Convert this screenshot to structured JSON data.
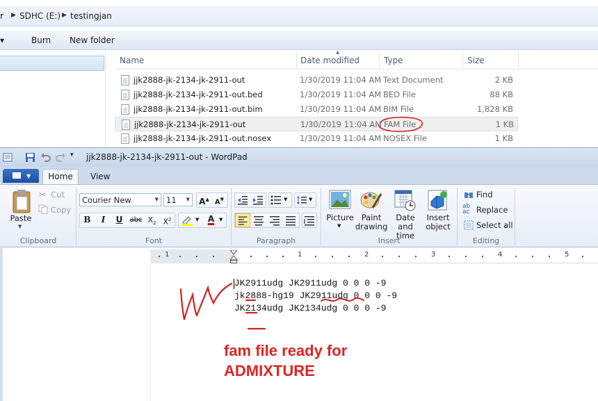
{
  "explorer": {
    "breadcrumb": [
      "r",
      "SDHC (E:)",
      "testingjan"
    ],
    "commands": {
      "burn": "Burn",
      "new_folder": "New folder"
    },
    "columns": {
      "name": "Name",
      "date": "Date modified",
      "type": "Type",
      "size": "Size"
    },
    "files": [
      {
        "name": "jjk2888-jk-2134-jk-2911-out",
        "date": "1/30/2019 11:04 AM",
        "type": "Text Document",
        "size": "2 KB"
      },
      {
        "name": "jjk2888-jk-2134-jk-2911-out.bed",
        "date": "1/30/2019 11:04 AM",
        "type": "BED File",
        "size": "88 KB"
      },
      {
        "name": "jjk2888-jk-2134-jk-2911-out.bim",
        "date": "1/30/2019 11:04 AM",
        "type": "BIM File",
        "size": "1,828 KB"
      },
      {
        "name": "jjk2888-jk-2134-jk-2911-out",
        "date": "1/30/2019 11:04 AM",
        "type": "FAM File",
        "size": "1 KB"
      },
      {
        "name": "jjk2888-jk-2134-jk-2911-out.nosex",
        "date": "1/30/2019 11:04 AM",
        "type": "NOSEX File",
        "size": "1 KB"
      }
    ]
  },
  "wordpad": {
    "title": "jjk2888-jk-2134-jk-2911-out - WordPad",
    "tabs": {
      "home": "Home",
      "view": "View"
    },
    "clipboard": {
      "paste": "Paste",
      "cut": "Cut",
      "copy": "Copy",
      "group": "Clipboard"
    },
    "font": {
      "family": "Courier New",
      "size": "11",
      "group": "Font"
    },
    "paragraph": {
      "group": "Paragraph"
    },
    "insert": {
      "picture": "Picture",
      "paint_1": "Paint",
      "paint_2": "drawing",
      "datetime_1": "Date and",
      "datetime_2": "time",
      "object_1": "Insert",
      "object_2": "object",
      "group": "Insert"
    },
    "editing": {
      "find": "Find",
      "replace": "Replace",
      "select_all": "Select all",
      "group": "Editing"
    },
    "ruler": [
      "1",
      "1",
      "2",
      "3",
      "4",
      "5"
    ],
    "document_lines": [
      "JK2911udg JK2911udg 0 0 0 -9",
      "jk2888-hg19 JK2911udg 0 0 0 -9",
      "JK2134udg JK2134udg 0 0 0 -9"
    ],
    "annotation": [
      "fam file ready for",
      "ADMIXTURE"
    ]
  },
  "colors": {
    "annotation_red": "#e02424",
    "ribbon_blue": "#1d4fa3"
  }
}
